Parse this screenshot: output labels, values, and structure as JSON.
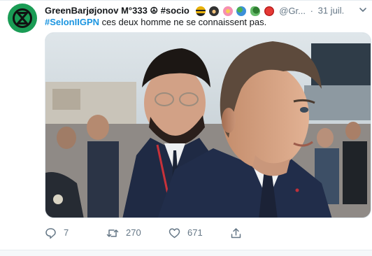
{
  "tweet": {
    "display_name": "GreenBarjøjonov M°333",
    "name_suffix": "☮ #socio",
    "handle": "@Gr...",
    "separator": "·",
    "date": "31 juil.",
    "hashtag": "#SelonIIGPN",
    "body": " ces deux homme ne se connaissent pas.",
    "emoji_icons": [
      "bee-emoji",
      "ninja-emoji",
      "flower-emoji",
      "globe-emoji",
      "dragon-emoji",
      "lobster-emoji"
    ],
    "avatar_icon": "extinction-rebellion-icon",
    "avatar_color": "#1a9c55"
  },
  "actions": {
    "replies": "7",
    "retweets": "270",
    "likes": "671"
  },
  "colors": {
    "hashtag": "#1b95e0",
    "muted": "#657786",
    "border": "#e6ecf0"
  }
}
